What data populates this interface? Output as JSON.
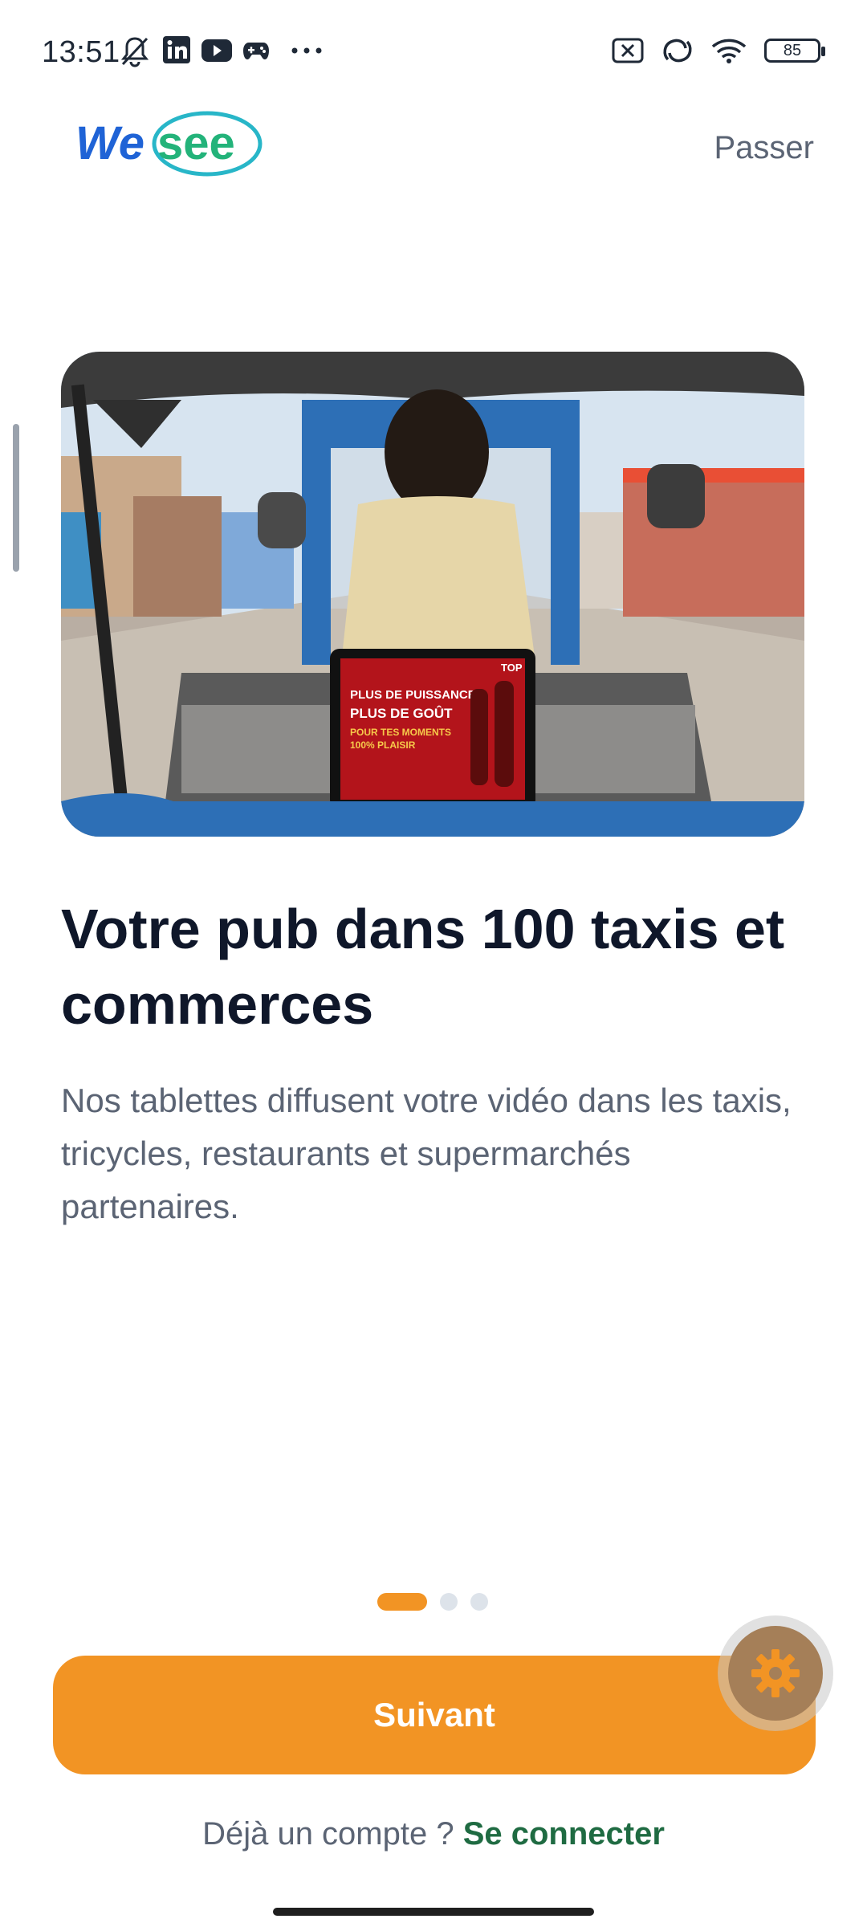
{
  "status_bar": {
    "time": "13:51",
    "battery": "85",
    "left_icons": [
      "bell-off-icon",
      "linkedin-icon",
      "youtube-icon",
      "gamepad-icon",
      "more-dots-icon"
    ],
    "right_icons": [
      "sim-off-icon",
      "hotspot-icon",
      "wifi-icon",
      "battery-icon"
    ]
  },
  "header": {
    "logo_text_part1": "We",
    "logo_text_part2": "see",
    "skip_label": "Passer"
  },
  "hero": {
    "ad_line1": "PLUS DE PUISSANCE",
    "ad_line2": "PLUS DE GOÛT",
    "ad_line3": "POUR TES MOMENTS",
    "ad_line4": "100% PLAISIR",
    "ad_brand": "TOP"
  },
  "content": {
    "title": "Votre pub dans 100 taxis et commerces",
    "description": "Nos tablettes diffusent votre vidéo dans les taxis, tricycles, restaurants et supermarchés partenaires."
  },
  "pagination": {
    "total": 3,
    "current": 1
  },
  "actions": {
    "next_label": "Suivant",
    "login_prompt": "Déjà un compte ?",
    "login_link": "Se connecter"
  },
  "colors": {
    "accent": "#f29424",
    "link_green": "#1f6b42",
    "text_dark": "#0f172a",
    "text_muted": "#5b6474"
  }
}
